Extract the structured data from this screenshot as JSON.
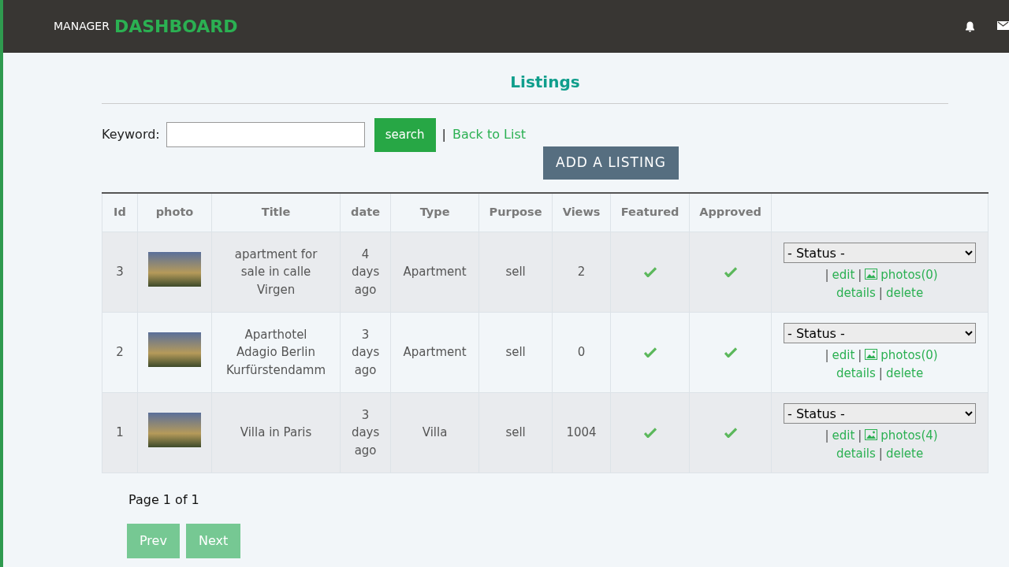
{
  "header": {
    "brand_small": "MANAGER",
    "brand_large": "DASHBOARD"
  },
  "page_title": "Listings",
  "search": {
    "label": "Keyword:",
    "button": "search",
    "separator": "|",
    "back_link": "Back to List"
  },
  "add_button": "ADD A LISTING",
  "table": {
    "columns": [
      "Id",
      "photo",
      "Title",
      "date",
      "Type",
      "Purpose",
      "Views",
      "Featured",
      "Approved"
    ],
    "rows": [
      {
        "id": "3",
        "title": "apartment for sale in calle Virgen",
        "date": "4 days ago",
        "type": "Apartment",
        "purpose": "sell",
        "views": "2",
        "featured": true,
        "approved": true,
        "status": "- Status -",
        "actions": [
          {
            "kind": "sep",
            "text": "|"
          },
          {
            "kind": "link",
            "text": "edit"
          },
          {
            "kind": "sep",
            "text": "|"
          },
          {
            "kind": "photos",
            "text": "photos(0)"
          },
          {
            "kind": "break"
          },
          {
            "kind": "link",
            "text": "details"
          },
          {
            "kind": "sep",
            "text": "|"
          },
          {
            "kind": "link",
            "text": "delete"
          }
        ]
      },
      {
        "id": "2",
        "title": "Aparthotel Adagio Berlin Kurfürstendamm",
        "date": "3 days ago",
        "type": "Apartment",
        "purpose": "sell",
        "views": "0",
        "featured": true,
        "approved": true,
        "status": "- Status -",
        "actions": [
          {
            "kind": "sep",
            "text": "|"
          },
          {
            "kind": "link",
            "text": "edit"
          },
          {
            "kind": "sep",
            "text": "|"
          },
          {
            "kind": "photos",
            "text": "photos(0)"
          },
          {
            "kind": "break"
          },
          {
            "kind": "link",
            "text": "details"
          },
          {
            "kind": "sep",
            "text": "|"
          },
          {
            "kind": "link",
            "text": "delete"
          }
        ]
      },
      {
        "id": "1",
        "title": "Villa in Paris",
        "date": "3 days ago",
        "type": "Villa",
        "purpose": "sell",
        "views": "1004",
        "featured": true,
        "approved": true,
        "status": "- Status -",
        "actions": [
          {
            "kind": "sep",
            "text": "|"
          },
          {
            "kind": "link",
            "text": "edit"
          },
          {
            "kind": "sep",
            "text": "|"
          },
          {
            "kind": "photos",
            "text": "photos(4)"
          },
          {
            "kind": "break"
          },
          {
            "kind": "link",
            "text": "details"
          },
          {
            "kind": "sep",
            "text": "|"
          },
          {
            "kind": "link",
            "text": "delete"
          }
        ]
      }
    ]
  },
  "pagination": {
    "info": "Page 1 of 1",
    "buttons": [
      {
        "label": "Prev",
        "disabled": true
      },
      {
        "label": "Next",
        "disabled": true
      }
    ]
  }
}
